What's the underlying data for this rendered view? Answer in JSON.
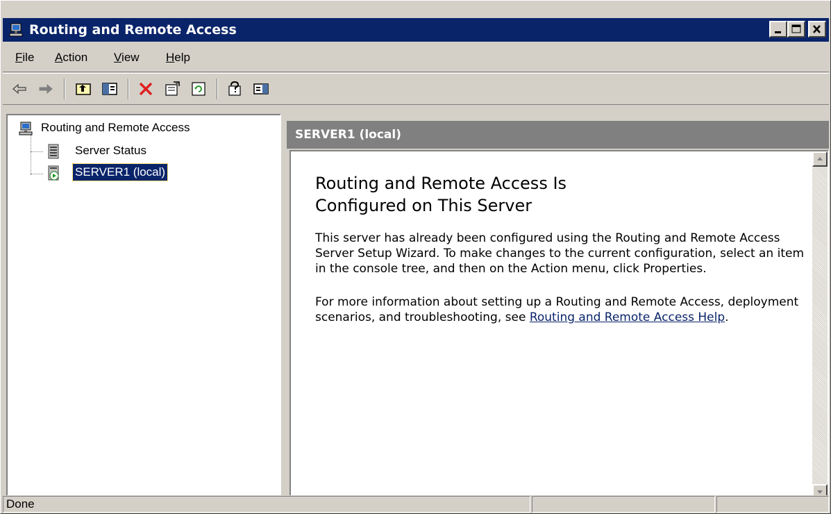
{
  "window": {
    "title": "Routing and Remote Access"
  },
  "menu": {
    "items": [
      {
        "label": "File",
        "mnemonic": "F",
        "rest": "ile"
      },
      {
        "label": "Action",
        "mnemonic": "A",
        "rest": "ction"
      },
      {
        "label": "View",
        "mnemonic": "V",
        "rest": "iew"
      },
      {
        "label": "Help",
        "mnemonic": "H",
        "rest": "elp"
      }
    ]
  },
  "toolbar": {
    "buttons": [
      "back-icon",
      "forward-icon",
      "up-one-level-icon",
      "show-hide-tree-icon",
      "delete-icon",
      "properties-icon",
      "refresh-icon",
      "help-icon",
      "show-hide-action-pane-icon"
    ]
  },
  "tree": {
    "root": "Routing and Remote Access",
    "children": [
      "Server Status",
      "SERVER1 (local)"
    ],
    "selected": "SERVER1 (local)"
  },
  "right_pane": {
    "header": "SERVER1 (local)",
    "heading_line1": "Routing and Remote Access Is",
    "heading_line2": "Configured on This Server",
    "para1": "This server has already been configured using the Routing and Remote Access Server Setup Wizard. To make changes to the current configuration, select an item in the console tree, and then on the Action menu, click Properties.",
    "para2_prefix": "For more information about setting up a Routing and Remote Access, deployment scenarios, and troubleshooting, see ",
    "para2_link": "Routing and Remote Access Help",
    "para2_suffix": "."
  },
  "statusbar": {
    "text": "Done"
  },
  "colors": {
    "titlebar": "#0a246a",
    "face": "#d4d0c8",
    "header": "#808080",
    "link": "#0a246a"
  }
}
